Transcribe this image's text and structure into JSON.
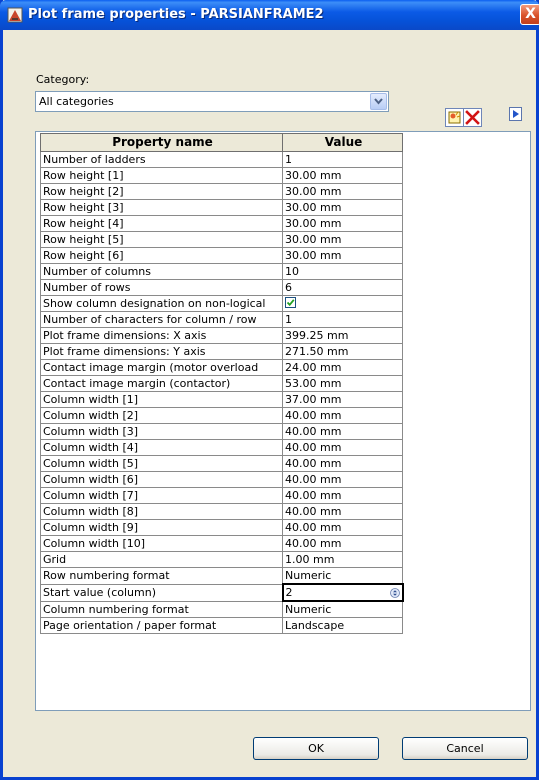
{
  "window": {
    "title": "Plot frame properties - PARSIANFRAME2",
    "close_glyph": "X"
  },
  "category": {
    "label": "Category:",
    "selected": "All categories"
  },
  "toolbar": {
    "icons": [
      "new-entry-icon",
      "delete-icon",
      "next-icon"
    ]
  },
  "table": {
    "headers": [
      "Property name",
      "Value"
    ],
    "rows": [
      {
        "name": "Number of ladders",
        "value": "1"
      },
      {
        "name": "Row height [1]",
        "value": "30.00 mm"
      },
      {
        "name": "Row height [2]",
        "value": "30.00 mm"
      },
      {
        "name": "Row height [3]",
        "value": "30.00 mm"
      },
      {
        "name": "Row height [4]",
        "value": "30.00 mm"
      },
      {
        "name": "Row height [5]",
        "value": "30.00 mm"
      },
      {
        "name": "Row height [6]",
        "value": "30.00 mm"
      },
      {
        "name": "Number of columns",
        "value": "10"
      },
      {
        "name": "Number of rows",
        "value": "6"
      },
      {
        "name": "Show column designation on non-logical",
        "value": "",
        "checkbox": true,
        "checked": true
      },
      {
        "name": "Number of characters for column / row",
        "value": "1"
      },
      {
        "name": "Plot frame dimensions: X axis",
        "value": "399.25 mm"
      },
      {
        "name": "Plot frame dimensions: Y axis",
        "value": "271.50 mm"
      },
      {
        "name": "Contact image margin (motor overload",
        "value": "24.00 mm"
      },
      {
        "name": "Contact image margin (contactor)",
        "value": "53.00 mm"
      },
      {
        "name": "Column width [1]",
        "value": "37.00 mm"
      },
      {
        "name": "Column width [2]",
        "value": "40.00 mm"
      },
      {
        "name": "Column width [3]",
        "value": "40.00 mm"
      },
      {
        "name": "Column width [4]",
        "value": "40.00 mm"
      },
      {
        "name": "Column width [5]",
        "value": "40.00 mm"
      },
      {
        "name": "Column width [6]",
        "value": "40.00 mm"
      },
      {
        "name": "Column width [7]",
        "value": "40.00 mm"
      },
      {
        "name": "Column width [8]",
        "value": "40.00 mm"
      },
      {
        "name": "Column width [9]",
        "value": "40.00 mm"
      },
      {
        "name": "Column width [10]",
        "value": "40.00 mm"
      },
      {
        "name": "Grid",
        "value": "1.00 mm"
      },
      {
        "name": "Row numbering format",
        "value": "Numeric"
      },
      {
        "name": "Start value (column)",
        "value": "2",
        "editing": true
      },
      {
        "name": "Column numbering format",
        "value": "Numeric"
      },
      {
        "name": "Page orientation / paper format",
        "value": "Landscape"
      }
    ]
  },
  "buttons": {
    "ok": "OK",
    "cancel": "Cancel"
  },
  "colors": {
    "titlebar": "#0b5ae6",
    "dialog_bg": "#ece9d8",
    "close_button": "#d9522a",
    "checkbox_check": "#21a121"
  }
}
